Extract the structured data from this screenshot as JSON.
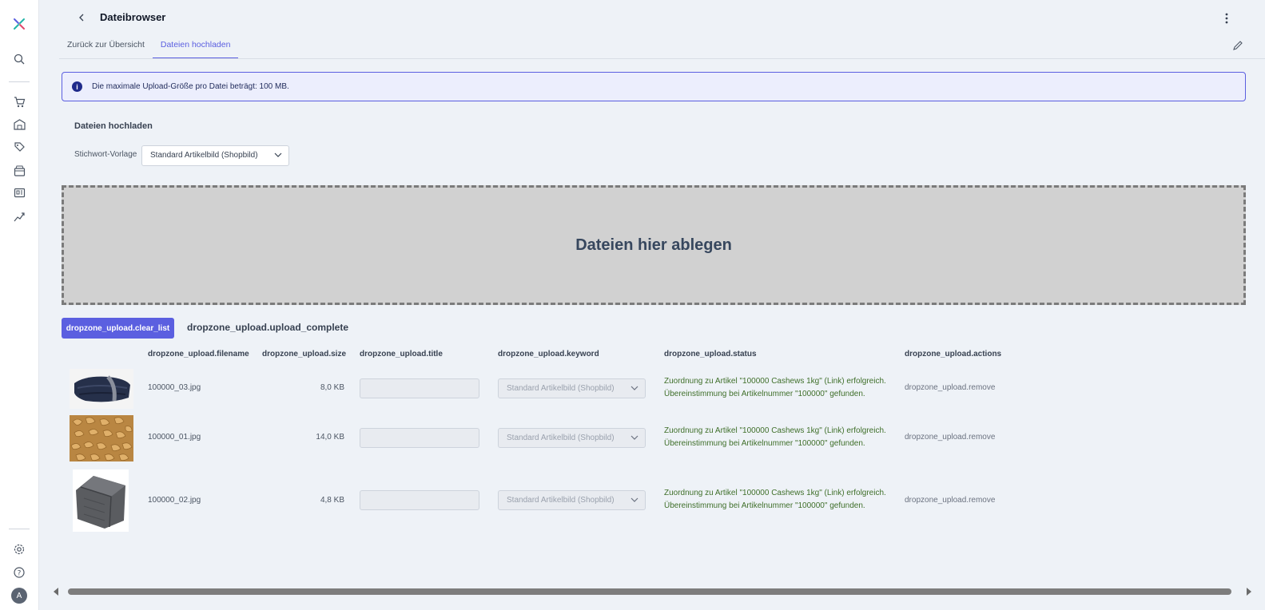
{
  "header": {
    "title": "Dateibrowser"
  },
  "tabs": [
    {
      "label": "Zurück zur Übersicht",
      "active": false
    },
    {
      "label": "Dateien hochladen",
      "active": true
    }
  ],
  "info": {
    "text": "Die maximale Upload-Größe pro Datei beträgt: 100 MB."
  },
  "upload": {
    "section_title": "Dateien hochladen",
    "keyword_label": "Stichwort-Vorlage",
    "keyword_selected": "Standard Artikelbild (Shopbild)",
    "dropzone_text": "Dateien hier ablegen",
    "clear_button": "dropzone_upload.clear_list",
    "complete_text": "dropzone_upload.upload_complete"
  },
  "table": {
    "headers": {
      "filename": "dropzone_upload.filename",
      "size": "dropzone_upload.size",
      "title": "dropzone_upload.title",
      "keyword": "dropzone_upload.keyword",
      "status": "dropzone_upload.status",
      "actions": "dropzone_upload.actions"
    },
    "rows": [
      {
        "thumb": "blanket-navy",
        "filename": "100000_03.jpg",
        "size": "8,0 KB",
        "keyword": "Standard Artikelbild (Shopbild)",
        "status_line1": "Zuordnung zu Artikel \"100000 Cashews 1kg\" (Link) erfolgreich.",
        "status_line2": "Übereinstimmung bei Artikelnummer \"100000\" gefunden.",
        "action": "dropzone_upload.remove"
      },
      {
        "thumb": "cashews",
        "filename": "100000_01.jpg",
        "size": "14,0 KB",
        "keyword": "Standard Artikelbild (Shopbild)",
        "status_line1": "Zuordnung zu Artikel \"100000 Cashews 1kg\" (Link) erfolgreich.",
        "status_line2": "Übereinstimmung bei Artikelnummer \"100000\" gefunden.",
        "action": "dropzone_upload.remove"
      },
      {
        "thumb": "blanket-grey",
        "filename": "100000_02.jpg",
        "size": "4,8 KB",
        "keyword": "Standard Artikelbild (Shopbild)",
        "status_line1": "Zuordnung zu Artikel \"100000 Cashews 1kg\" (Link) erfolgreich.",
        "status_line2": "Übereinstimmung bei Artikelnummer \"100000\" gefunden.",
        "action": "dropzone_upload.remove"
      }
    ]
  },
  "sidebar": {
    "avatar_initial": "A",
    "icons": [
      "logo-icon",
      "search-icon",
      "cart-icon",
      "warehouse-icon",
      "tag-icon",
      "storefront-icon",
      "pos-icon",
      "analytics-icon",
      "settings-icon",
      "help-icon"
    ]
  },
  "colors": {
    "accent": "#5b5fe0",
    "status_success": "#3f6f2a",
    "dropzone_bg": "#d1d1d1"
  }
}
